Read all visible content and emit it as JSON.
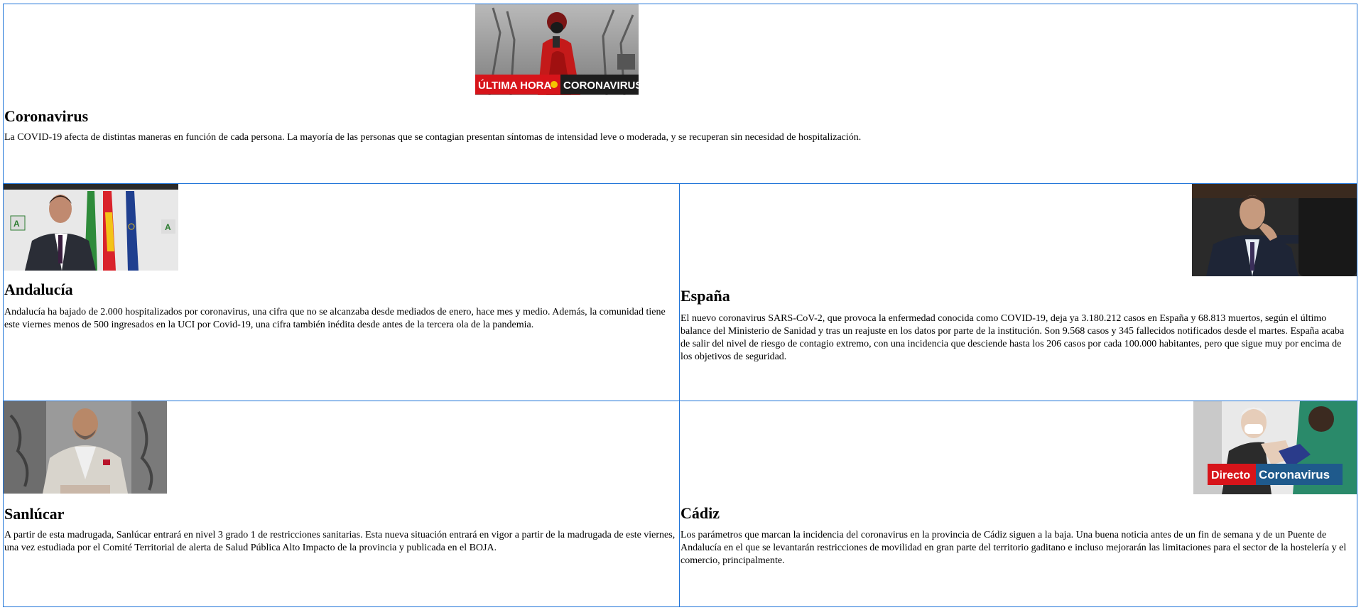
{
  "articles": [
    {
      "title": "Coronavirus",
      "body": "La COVID-19 afecta de distintas maneras en función de cada persona. La mayoría de las personas que se contagian presentan síntomas de intensidad leve o moderada, y se recuperan sin necesidad de hospitalización.",
      "image": {
        "icon": "breaking-news-photo",
        "overlay_left": "ÚLTIMA HORA",
        "overlay_right": "CORONAVIRUS"
      }
    },
    {
      "title": "Andalucía",
      "body": "Andalucía ha bajado de 2.000 hospitalizados por coronavirus, una cifra que no se alcanzaba desde mediados de enero, hace mes y medio. Además, la comunidad tiene este viernes menos de 500 ingresados en la UCI por Covid-19, una cifra también inédita desde antes de la tercera ola de la pandemia.",
      "image": {
        "icon": "press-conference-photo"
      }
    },
    {
      "title": "España",
      "body": "El nuevo coronavirus SARS-CoV-2, que provoca la enfermedad conocida como COVID-19, deja ya 3.180.212 casos en España y 68.813 muertos, según el último balance del Ministerio de Sanidad y tras un reajuste en los datos por parte de la institución. Son 9.568 casos y 345 fallecidos notificados desde el martes. España acaba de salir del nivel de riesgo de contagio extremo, con una incidencia que desciende hasta los 206 casos por cada 100.000 habitantes, pero que sigue muy por encima de los objetivos de seguridad.",
      "image": {
        "icon": "parliament-photo"
      }
    },
    {
      "title": "Sanlúcar",
      "body": "A partir de esta madrugada, Sanlúcar entrará en nivel 3 grado 1 de restricciones sanitarias. Esta nueva situación entrará en vigor a partir de la madrugada de este viernes, una vez estudiada por el Comité Territorial de alerta de Salud Pública Alto Impacto de la provincia y publicada en el BOJA.",
      "image": {
        "icon": "mayor-photo"
      }
    },
    {
      "title": "Cádiz",
      "body": "Los parámetros que marcan la incidencia del coronavirus en la provincia de Cádiz siguen a la baja. Una buena noticia antes de un fin de semana y de un Puente de Andalucía en el que se levantarán restricciones de movilidad en gran parte del territorio gaditano e incluso mejorarán las limitaciones para el sector de la hostelería y el comercio, principalmente.",
      "image": {
        "icon": "vaccination-photo",
        "overlay_left": "Directo",
        "overlay_right": "Coronavirus"
      }
    }
  ],
  "colors": {
    "border": "#1e73d8",
    "badge_red": "#d7141a",
    "badge_blue": "#1f5a8c"
  }
}
